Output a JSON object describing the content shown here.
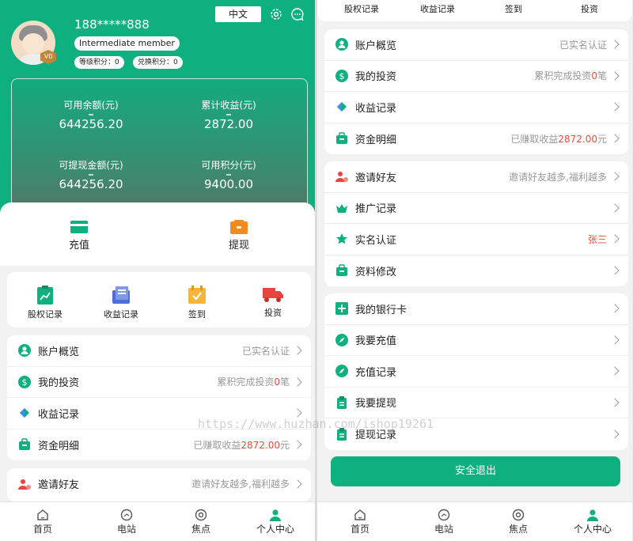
{
  "profile": {
    "phone": "188*****888",
    "member_level": "Intermediate member",
    "avatar_badge": "V0",
    "grade_points": "等级积分：0",
    "exchange_points": "兑换积分：0",
    "language_button": "中文"
  },
  "balances": [
    {
      "label": "可用余额(元)",
      "value": "644256.20"
    },
    {
      "label": "累计收益(元)",
      "value": "2872.00"
    },
    {
      "label": "可提现金额(元)",
      "value": "644256.20"
    },
    {
      "label": "可用积分(元)",
      "value": "9400.00"
    }
  ],
  "actions": {
    "recharge": "充值",
    "withdraw": "提现"
  },
  "grid": [
    "股权记录",
    "收益记录",
    "签到",
    "投资"
  ],
  "menu_account": [
    {
      "label": "账户概览",
      "sub": "已实名认证"
    },
    {
      "label": "我的投资",
      "sub_prefix": "累积完成投资",
      "sub_highlight": "0",
      "sub_suffix": "笔"
    },
    {
      "label": "收益记录",
      "sub": ""
    },
    {
      "label": "资金明细",
      "sub_prefix": "已赚取收益",
      "sub_highlight": "2872.00",
      "sub_suffix": "元"
    }
  ],
  "menu_invite": [
    {
      "label": "邀请好友",
      "sub": "邀请好友越多,福利越多"
    },
    {
      "label": "推广记录",
      "sub": ""
    },
    {
      "label": "实名认证",
      "sub": "张三"
    },
    {
      "label": "资料修改",
      "sub": ""
    }
  ],
  "menu_bank": [
    {
      "label": "我的银行卡"
    },
    {
      "label": "我要充值"
    },
    {
      "label": "充值记录"
    },
    {
      "label": "我要提现"
    },
    {
      "label": "提现记录"
    }
  ],
  "logout": "安全退出",
  "nav": [
    "首页",
    "电站",
    "焦点",
    "个人中心"
  ],
  "watermark": "https://www.huzhan.com/ishop19261",
  "colors": {
    "primary": "#0fb07f",
    "highlight": "#e84d3d",
    "muted": "#999999"
  }
}
